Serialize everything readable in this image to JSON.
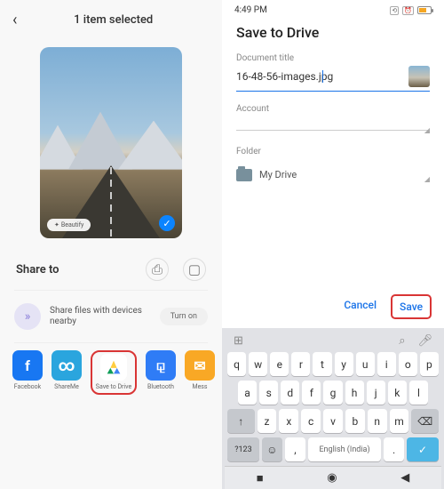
{
  "left": {
    "title": "1 item selected",
    "beautify_label": "Beautify",
    "share_label": "Share to",
    "nearby_text": "Share files with devices nearby",
    "turnon_label": "Turn on",
    "apps": {
      "facebook": "Facebook",
      "shareme": "ShareMe",
      "drive": "Save to Drive",
      "bluetooth": "Bluetooth",
      "messenger": "Mess"
    }
  },
  "right": {
    "time": "4:49 PM",
    "title": "Save to Drive",
    "doc_title_label": "Document title",
    "doc_title_value": "16-48-56-images.jpg",
    "account_label": "Account",
    "folder_label": "Folder",
    "folder_value": "My Drive",
    "cancel_label": "Cancel",
    "save_label": "Save"
  },
  "keyboard": {
    "row1": [
      "q",
      "w",
      "e",
      "r",
      "t",
      "y",
      "u",
      "i",
      "o",
      "p"
    ],
    "row2": [
      "a",
      "s",
      "d",
      "f",
      "g",
      "h",
      "j",
      "k",
      "l"
    ],
    "row3": [
      "z",
      "x",
      "c",
      "v",
      "b",
      "n",
      "m"
    ],
    "shift": "↑",
    "backspace": "⌫",
    "sym": "?123",
    "emoji": "☺",
    "comma": ",",
    "space": "English (India)",
    "period": ".",
    "enter": "✓"
  }
}
